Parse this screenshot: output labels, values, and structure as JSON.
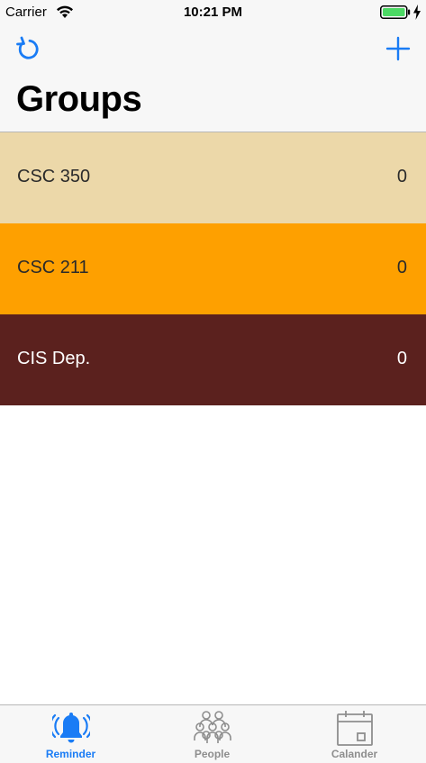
{
  "status_bar": {
    "carrier": "Carrier",
    "time": "10:21 PM",
    "wifi_icon": "wifi-icon",
    "battery_icon": "battery-icon",
    "charging_icon": "charging-bolt-icon"
  },
  "nav": {
    "title": "Groups",
    "refresh_icon": "refresh-icon",
    "add_icon": "plus-icon",
    "tint": "#1a7cf5"
  },
  "groups": [
    {
      "name": "CSC 350",
      "count": "0",
      "bg": "#ecd8a9",
      "fg": "#2a2a2a"
    },
    {
      "name": "CSC 211",
      "count": "0",
      "bg": "#fea000",
      "fg": "#2a2a2a"
    },
    {
      "name": "CIS Dep.",
      "count": "0",
      "bg": "#5b211e",
      "fg": "#ffffff"
    }
  ],
  "tabs": [
    {
      "label": "Reminder",
      "icon": "bell-icon",
      "selected": true
    },
    {
      "label": "People",
      "icon": "people-icon",
      "selected": false
    },
    {
      "label": "Calander",
      "icon": "calendar-icon",
      "selected": false
    }
  ],
  "colors": {
    "tab_active": "#1a7cf5",
    "tab_inactive": "#8e8e8e"
  }
}
